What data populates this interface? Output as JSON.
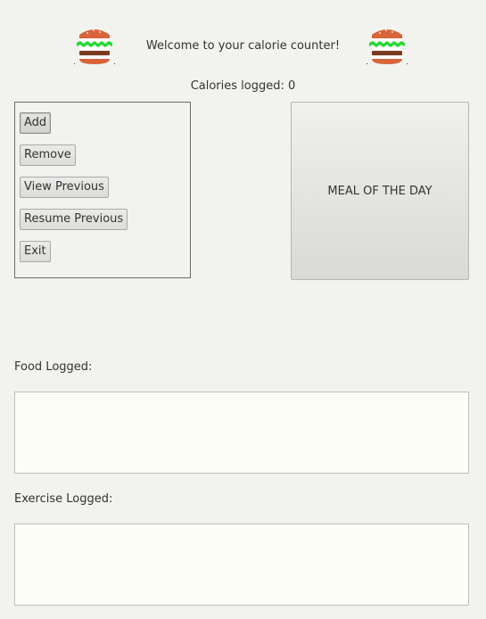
{
  "header": {
    "welcome": "Welcome to your calorie counter!",
    "calories": "Calories logged: 0",
    "left_icon": "burger-icon",
    "right_icon": "burger-icon"
  },
  "menu": {
    "buttons": [
      "Add",
      "Remove",
      "View Previous",
      "Resume Previous",
      "Exit"
    ]
  },
  "meal_button": "MEAL OF THE DAY",
  "food": {
    "label": "Food Logged:",
    "value": ""
  },
  "exercise": {
    "label": "Exercise Logged:",
    "value": ""
  }
}
